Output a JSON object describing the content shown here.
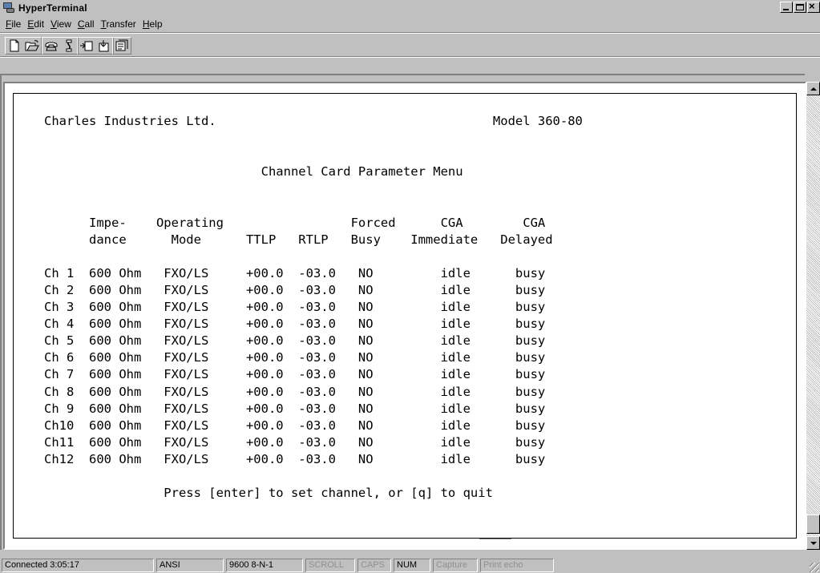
{
  "window": {
    "title": "HyperTerminal"
  },
  "menu": [
    {
      "label": "File",
      "key": "F",
      "rest": "ile"
    },
    {
      "label": "Edit",
      "key": "E",
      "rest": "dit"
    },
    {
      "label": "View",
      "key": "V",
      "rest": "iew"
    },
    {
      "label": "Call",
      "key": "C",
      "rest": "all"
    },
    {
      "label": "Transfer",
      "key": "T",
      "rest": "ransfer"
    },
    {
      "label": "Help",
      "key": "H",
      "rest": "elp"
    }
  ],
  "toolbar": {
    "icons": [
      "new-icon",
      "open-icon",
      "connect-icon",
      "disconnect-icon",
      "send-icon",
      "receive-icon",
      "properties-icon"
    ]
  },
  "terminal": {
    "lines": [
      "Charles Industries Ltd.                                     Model 360-80",
      "",
      "",
      "                             Channel Card Parameter Menu",
      "",
      "",
      "      Impe-    Operating                 Forced      CGA        CGA",
      "      dance      Mode      TTLP   RTLP   Busy    Immediate   Delayed",
      "",
      "Ch 1  600 Ohm   FXO/LS     +00.0  -03.0   NO         idle      busy",
      "Ch 2  600 Ohm   FXO/LS     +00.0  -03.0   NO         idle      busy",
      "Ch 3  600 Ohm   FXO/LS     +00.0  -03.0   NO         idle      busy",
      "Ch 4  600 Ohm   FXO/LS     +00.0  -03.0   NO         idle      busy",
      "Ch 5  600 Ohm   FXO/LS     +00.0  -03.0   NO         idle      busy",
      "Ch 6  600 Ohm   FXO/LS     +00.0  -03.0   NO         idle      busy",
      "Ch 7  600 Ohm   FXO/LS     +00.0  -03.0   NO         idle      busy",
      "Ch 8  600 Ohm   FXO/LS     +00.0  -03.0   NO         idle      busy",
      "Ch 9  600 Ohm   FXO/LS     +00.0  -03.0   NO         idle      busy",
      "Ch10  600 Ohm   FXO/LS     +00.0  -03.0   NO         idle      busy",
      "Ch11  600 Ohm   FXO/LS     +00.0  -03.0   NO         idle      busy",
      "Ch12  600 Ohm   FXO/LS     +00.0  -03.0   NO         idle      busy",
      "",
      "                Press [enter] to set channel, or [q] to quit"
    ]
  },
  "statusbar": {
    "connected": "Connected 3:05:17",
    "emulation": "ANSI",
    "port": "9600 8-N-1",
    "scroll": "SCROLL",
    "caps": "CAPS",
    "num": "NUM",
    "capture": "Capture",
    "print_echo": "Print echo"
  }
}
